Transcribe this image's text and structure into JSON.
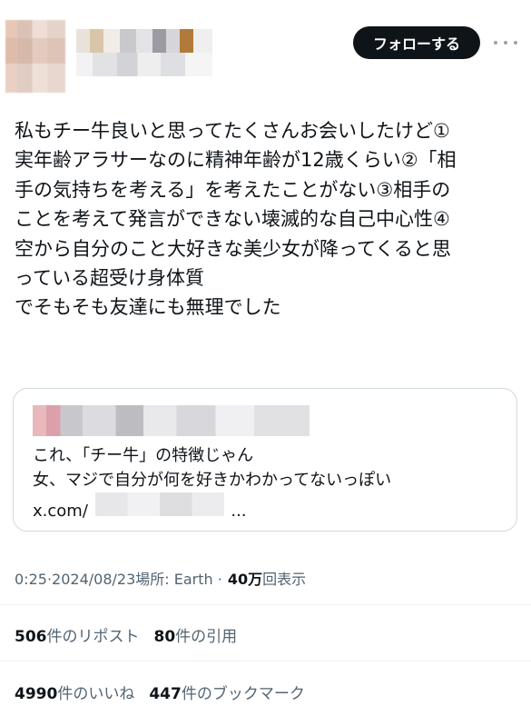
{
  "header": {
    "follow_label": "フォローする"
  },
  "tweet": {
    "lines": [
      "私もチー牛良いと思ってたくさんお会いしたけど①",
      "実年齢アラサーなのに精神年齢が12歳くらい②「相",
      "手の気持ちを考える」を考えたことがない③相手の",
      "ことを考えて発言ができない壊滅的な自己中心性④",
      "空から自分のこと大好きな美少女が降ってくると思",
      "っている超受け身体質",
      "でそもそも友達にも無理でした"
    ]
  },
  "quote": {
    "lines": [
      "これ、「チー牛」の特徴じゃん",
      "女、マジで自分が何を好きかわかってないっぽい"
    ],
    "link_prefix": "x.com/",
    "link_suffix": "..."
  },
  "meta": {
    "time": "0:25",
    "sep1": " · ",
    "date": "2024/08/23",
    "location": " 場所: Earth · ",
    "views_count": "40万",
    "views_label": "回表示"
  },
  "stats": {
    "reposts_count": "506",
    "reposts_label": "件のリポスト",
    "quotes_count": "80",
    "quotes_label": "件の引用",
    "likes_count": "4990",
    "likes_label": "件のいいね",
    "bookmarks_count": "447",
    "bookmarks_label": "件のブックマーク"
  }
}
